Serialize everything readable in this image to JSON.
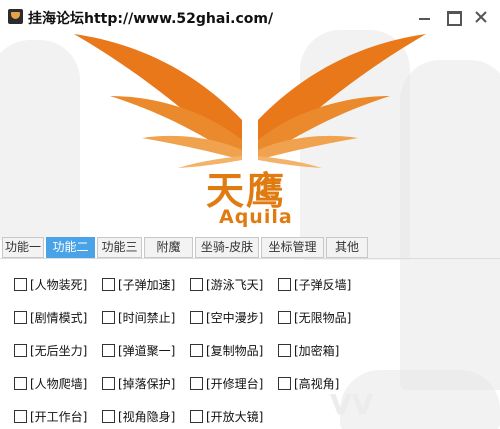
{
  "window": {
    "title": "挂海论坛http://www.52ghai.com/"
  },
  "logo": {
    "cn": "天鹰",
    "en": "Aquila"
  },
  "tabs": [
    {
      "label": "功能一",
      "active": false
    },
    {
      "label": "功能二",
      "active": true
    },
    {
      "label": "功能三",
      "active": false
    },
    {
      "label": "附魔",
      "active": false
    },
    {
      "label": "坐骑-皮肤",
      "active": false
    },
    {
      "label": "坐标管理",
      "active": false
    },
    {
      "label": "其他",
      "active": false
    }
  ],
  "options": [
    [
      "[人物装死]",
      "[子弹加速]",
      "[游泳飞天]",
      "[子弹反墙]"
    ],
    [
      "[剧情模式]",
      "[时间禁止]",
      "[空中漫步]",
      "[无限物品]"
    ],
    [
      "[无后坐力]",
      "[弹道聚一]",
      "[复制物品]",
      "[加密箱]"
    ],
    [
      "[人物爬墙]",
      "[掉落保护]",
      "[开修理台]",
      "[高视角]"
    ],
    [
      "[开工作台]",
      "[视角隐身]",
      "[开放大镜]"
    ]
  ],
  "colors": {
    "accent": "#4aa3e6",
    "brand": "#e07b12",
    "wing_dark": "#e8781a",
    "wing_light": "#f4b36a"
  }
}
